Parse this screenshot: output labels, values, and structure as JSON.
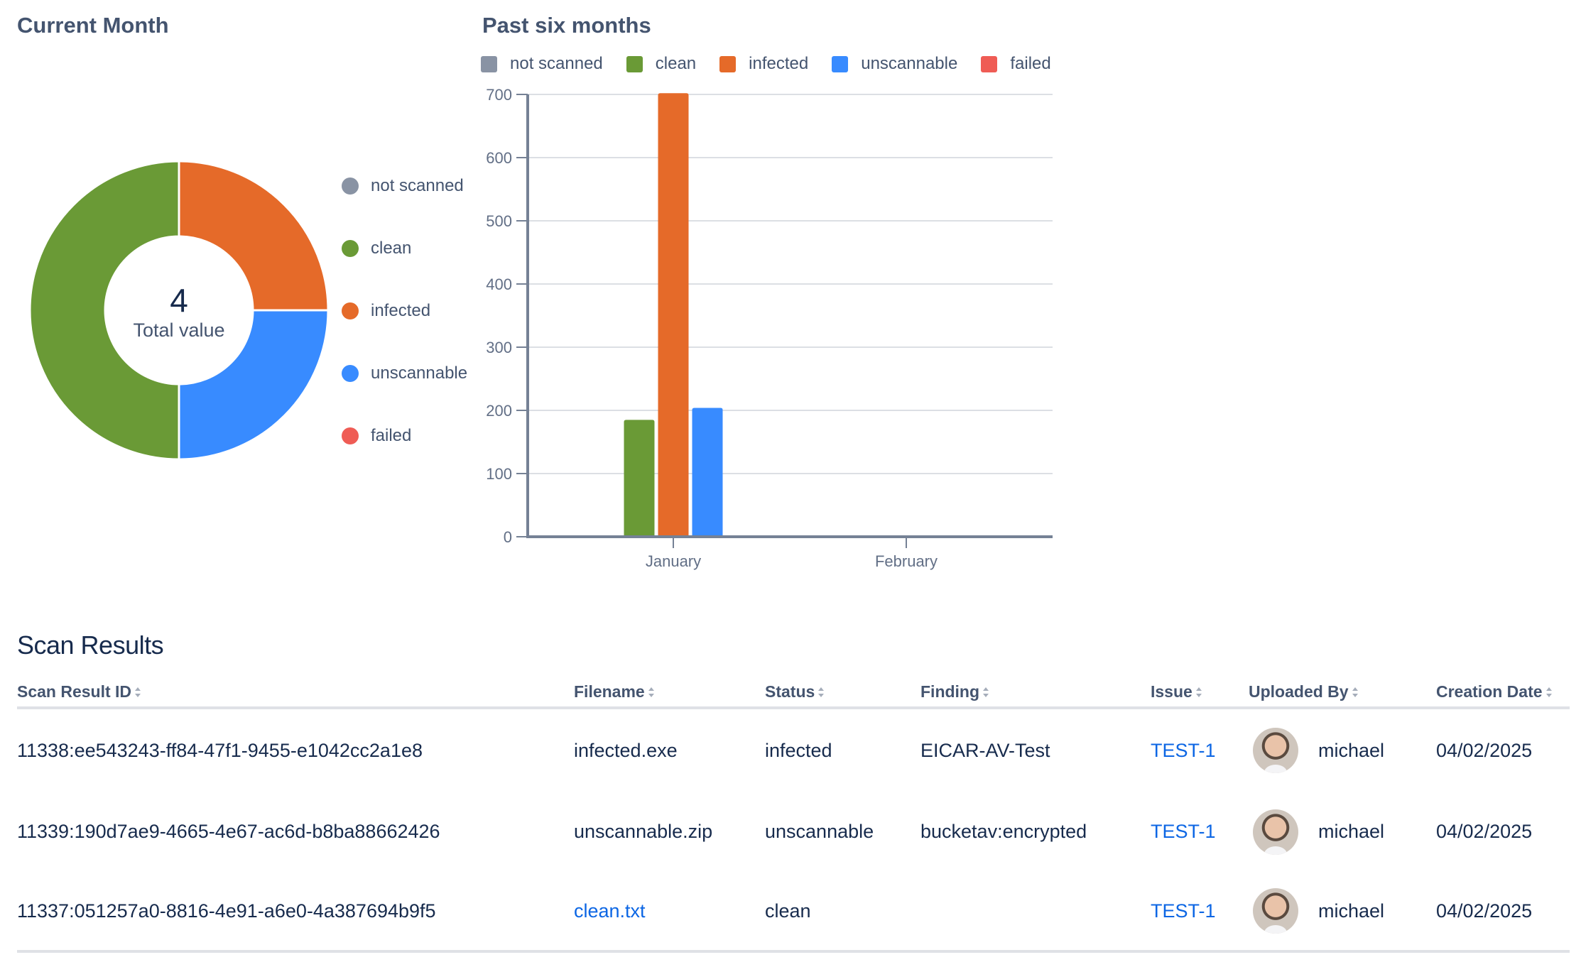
{
  "current_month": {
    "title": "Current Month",
    "total_value": "4",
    "total_label": "Total value"
  },
  "past_six_months": {
    "title": "Past six months"
  },
  "colors": {
    "not_scanned": "#8993A4",
    "clean": "#6A9A36",
    "infected": "#E56A29",
    "unscannable": "#388BFF",
    "failed": "#EF5C55"
  },
  "chart_data": [
    {
      "type": "pie",
      "title": "Current Month",
      "donut": true,
      "center_text": "4",
      "center_subtext": "Total value",
      "legend_position": "right",
      "categories": [
        "not scanned",
        "clean",
        "infected",
        "unscannable",
        "failed"
      ],
      "values": [
        0,
        2,
        1,
        1,
        0
      ],
      "colors": [
        "#8993A4",
        "#6A9A36",
        "#E56A29",
        "#388BFF",
        "#EF5C55"
      ]
    },
    {
      "type": "bar",
      "title": "Past six months",
      "xlabel": "",
      "ylabel": "",
      "categories": [
        "January",
        "February"
      ],
      "ylim": [
        0,
        700
      ],
      "yticks": [
        0,
        100,
        200,
        300,
        400,
        500,
        600,
        700
      ],
      "grid": true,
      "legend_position": "top-left",
      "series": [
        {
          "name": "not scanned",
          "color": "#8993A4",
          "values": [
            0,
            0
          ]
        },
        {
          "name": "clean",
          "color": "#6A9A36",
          "values": [
            185,
            0
          ]
        },
        {
          "name": "infected",
          "color": "#E56A29",
          "values": [
            702,
            0
          ]
        },
        {
          "name": "unscannable",
          "color": "#388BFF",
          "values": [
            204,
            0
          ]
        },
        {
          "name": "failed",
          "color": "#EF5C55",
          "values": [
            0,
            0
          ]
        }
      ]
    }
  ],
  "scan_results": {
    "title": "Scan Results",
    "columns": [
      "Scan Result ID",
      "Filename",
      "Status",
      "Finding",
      "Issue",
      "Uploaded By",
      "Creation Date"
    ],
    "rows": [
      {
        "id": "11338:ee543243-ff84-47f1-9455-e1042cc2a1e8",
        "filename": "infected.exe",
        "filename_link": false,
        "status": "infected",
        "finding": "EICAR-AV-Test",
        "issue": "TEST-1",
        "uploaded_by": "michael",
        "creation_date": "04/02/2025"
      },
      {
        "id": "11339:190d7ae9-4665-4e67-ac6d-b8ba88662426",
        "filename": "unscannable.zip",
        "filename_link": false,
        "status": "unscannable",
        "finding": "bucketav:encrypted",
        "issue": "TEST-1",
        "uploaded_by": "michael",
        "creation_date": "04/02/2025"
      },
      {
        "id": "11337:051257a0-8816-4e91-a6e0-4a387694b9f5",
        "filename": "clean.txt",
        "filename_link": true,
        "status": "clean",
        "finding": "",
        "issue": "TEST-1",
        "uploaded_by": "michael",
        "creation_date": "04/02/2025"
      }
    ]
  }
}
